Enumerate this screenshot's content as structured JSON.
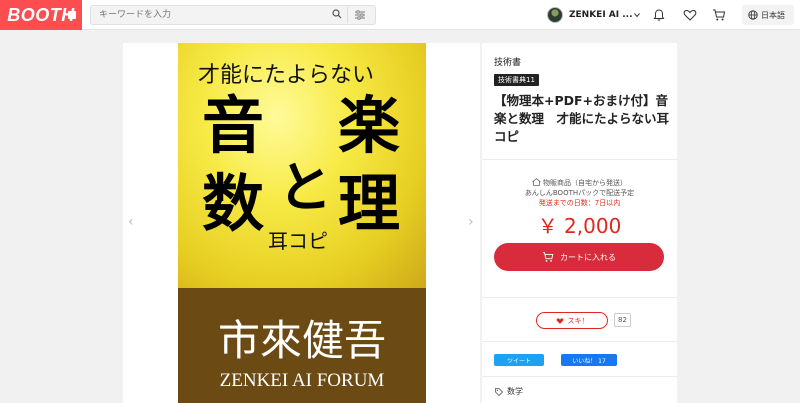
{
  "header": {
    "logo": "BOOTH",
    "search": {
      "placeholder": "キーワードを入力"
    },
    "user_name": "ZENKEI AI ...",
    "language": "日本語"
  },
  "cover": {
    "subtitle": "才能にたよらない",
    "char_1": "音",
    "char_2": "楽",
    "char_3": "と",
    "char_4": "数",
    "char_5": "理",
    "ear": "耳コピ",
    "author": "市來健吾",
    "publisher": "ZENKEI AI FORUM"
  },
  "product": {
    "category": "技術書",
    "event_badge": "技術書典11",
    "title": "【物理本+PDF+おまけ付】音楽と数理　才能にたよらない耳コピ",
    "shipping_type": "物販商品（自宅から発送）",
    "shipping_method": "あんしんBOOTHパックで配送予定",
    "shipping_days": "発送までの日数：7日以内",
    "price": "￥ 2,000",
    "cart_label": "カートに入れる",
    "like_label": "スキ！",
    "like_count": "82",
    "tweet_label": "ツイート",
    "fb_label": "いいね！ 17",
    "tag": "数学"
  },
  "colors": {
    "brand": "#fc4d50",
    "price": "#e0281e",
    "cart_button": "#d82c3c"
  }
}
